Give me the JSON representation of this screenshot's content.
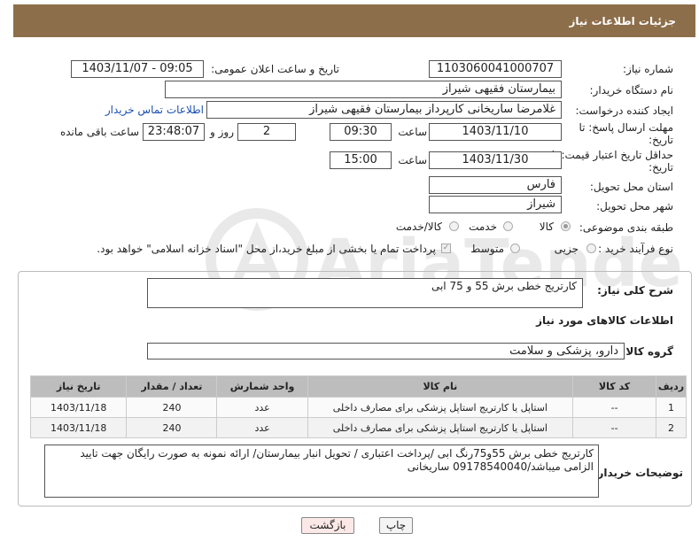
{
  "header": {
    "title": "جزئیات اطلاعات نیاز"
  },
  "form": {
    "need_number_label": "شماره نیاز:",
    "need_number": "1103060041000707",
    "announce_label": "تاریخ و ساعت اعلان عمومی:",
    "announce_value": "1403/11/07 - 09:05",
    "buyer_label": "نام دستگاه خریدار:",
    "buyer_value": "بیمارستان فقیهی شیراز",
    "creator_label": "ایجاد کننده درخواست:",
    "creator_value": "غلامرضا ساریخانی کارپرداز بیمارستان فقیهی شیراز",
    "contact_link": "اطلاعات تماس خریدار",
    "deadline_label_1": "مهلت ارسال پاسخ: تا",
    "deadline_label_2": "تاریخ:",
    "deadline_date": "1403/11/10",
    "time_label": "ساعت",
    "deadline_time": "09:30",
    "days_value": "2",
    "days_label": "روز و",
    "remaining_time": "23:48:07",
    "remaining_label": "ساعت باقی مانده",
    "validity_label_1": "حداقل تاریخ اعتبار قیمت: تا",
    "validity_label_2": "تاریخ:",
    "validity_date": "1403/11/30",
    "validity_time": "15:00",
    "province_label": "استان محل تحویل:",
    "province_value": "فارس",
    "city_label": "شهر محل تحویل:",
    "city_value": "شیراز",
    "category_label": "طبقه بندی موضوعی:",
    "category_options": [
      "کالا",
      "خدمت",
      "کالا/خدمت"
    ],
    "category_selected": "کالا",
    "process_label": "نوع فرآیند خرید :",
    "process_options": [
      "جزیی",
      "متوسط"
    ],
    "process_note": "پرداخت تمام یا بخشی از مبلغ خرید،از محل \"اسناد خزانه اسلامی\" خواهد بود."
  },
  "summary": {
    "label": "شرح کلی نیاز:",
    "value": "کارتریج خطی برش 55 و 75 ابی",
    "items_title": "اطلاعات کالاهای مورد نیاز",
    "group_label": "گروه کالا:",
    "group_value": "دارو، پزشکی و سلامت"
  },
  "table": {
    "headers": [
      "ردیف",
      "کد کالا",
      "نام کالا",
      "واحد شمارش",
      "تعداد / مقدار",
      "تاریخ نیاز"
    ],
    "rows": [
      [
        "1",
        "--",
        "استاپل یا کارتریج استاپل پزشکی برای مصارف داخلی",
        "عدد",
        "240",
        "1403/11/18"
      ],
      [
        "2",
        "--",
        "استاپل یا کارتریج استاپل پزشکی برای مصارف داخلی",
        "عدد",
        "240",
        "1403/11/18"
      ]
    ]
  },
  "notes": {
    "label": "توضیحات خریدار:",
    "value": "کارتریج خطی برش 55و75رنگ ابی /پرداخت اعتباری / تحویل انبار بیمارستان/ ارائه نمونه به صورت رایگان جهت تایید الزامی میباشد/09178540040 ساریخانی"
  },
  "buttons": {
    "print": "چاپ",
    "back": "بازگشت"
  },
  "watermark": {
    "text": "AriaTender.net"
  },
  "colors": {
    "header_bg": "#8d6e4a",
    "link": "#1a4fb0",
    "table_header": "#bdbdbd",
    "back_button_bg": "#fde8e8"
  }
}
